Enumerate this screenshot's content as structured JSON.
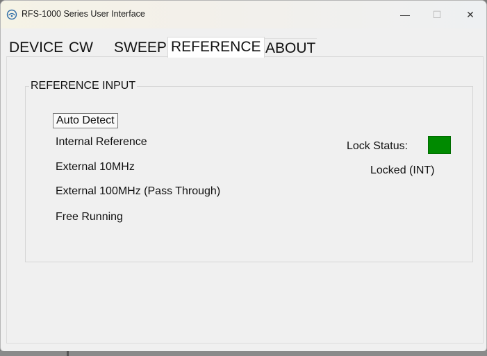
{
  "window": {
    "title": "RFS-1000 Series User Interface",
    "controls": {
      "minimize": "—",
      "maximize": "☐",
      "close": "✕"
    }
  },
  "tabs": [
    {
      "label": "DEVICE",
      "active": false
    },
    {
      "label": "CW",
      "active": false
    },
    {
      "label": "SWEEP",
      "active": false
    },
    {
      "label": "REFERENCE",
      "active": true
    },
    {
      "label": "ABOUT",
      "active": false
    }
  ],
  "reference": {
    "group_title": "REFERENCE INPUT",
    "options": [
      "Auto Detect",
      "Internal Reference",
      "External 10MHz",
      "External 100MHz (Pass Through)",
      "Free Running"
    ],
    "selected": "Auto Detect",
    "lock_status_label": "Lock Status:",
    "lock_status_color": "#008a00",
    "lock_status_text": "Locked (INT)"
  }
}
